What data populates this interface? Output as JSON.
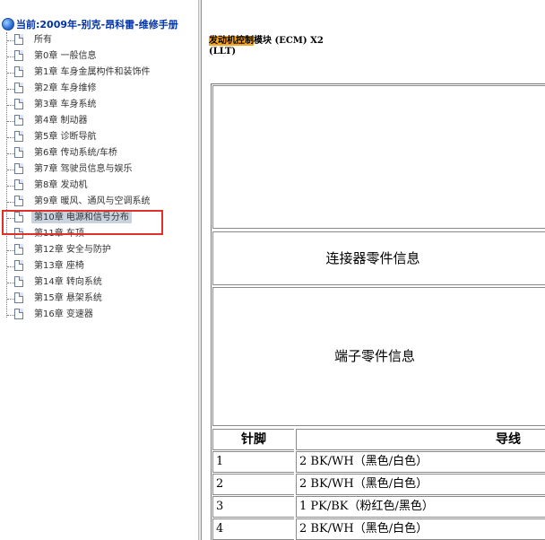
{
  "tree": {
    "title": "当前:2009年-别克-昂科雷-维修手册",
    "items": [
      {
        "label": "所有"
      },
      {
        "label": "第0章 一般信息"
      },
      {
        "label": "第1章 车身金属构件和装饰件"
      },
      {
        "label": "第2章 车身维修"
      },
      {
        "label": "第3章 车身系统"
      },
      {
        "label": "第4章 制动器"
      },
      {
        "label": "第5章 诊断导航"
      },
      {
        "label": "第6章 传动系统/车桥"
      },
      {
        "label": "第7章 驾驶员信息与娱乐"
      },
      {
        "label": "第8章 发动机"
      },
      {
        "label": "第9章 暖风、通风与空调系统"
      },
      {
        "label": "第10章 电源和信号分布"
      },
      {
        "label": "第11章 车顶"
      },
      {
        "label": "第12章 安全与防护"
      },
      {
        "label": "第13章 座椅"
      },
      {
        "label": "第14章 转向系统"
      },
      {
        "label": "第15章 悬架系统"
      },
      {
        "label": "第16章 变速器"
      }
    ],
    "selected_label": "第10章 电源和信号分布"
  },
  "doc": {
    "title_highlight": "发动机控制",
    "title_rest": "模块 (ECM) X2",
    "subtitle": "(LLT)",
    "connector_info": "连接器零件信息",
    "terminal_info": "端子零件信息",
    "table": {
      "header_pin": "针脚",
      "header_wire": "导线",
      "rows": [
        {
          "pin": "1",
          "wire": "2 BK/WH（黑色/白色）"
        },
        {
          "pin": "2",
          "wire": "2 BK/WH（黑色/白色）"
        },
        {
          "pin": "3",
          "wire": "1 PK/BK（粉红色/黑色）"
        },
        {
          "pin": "4",
          "wire": "2 BK/WH（黑色/白色）"
        }
      ]
    }
  },
  "colors": {
    "highlight": "#f5a623",
    "selection_box": "#e0302a",
    "tree_title": "#0033aa"
  }
}
